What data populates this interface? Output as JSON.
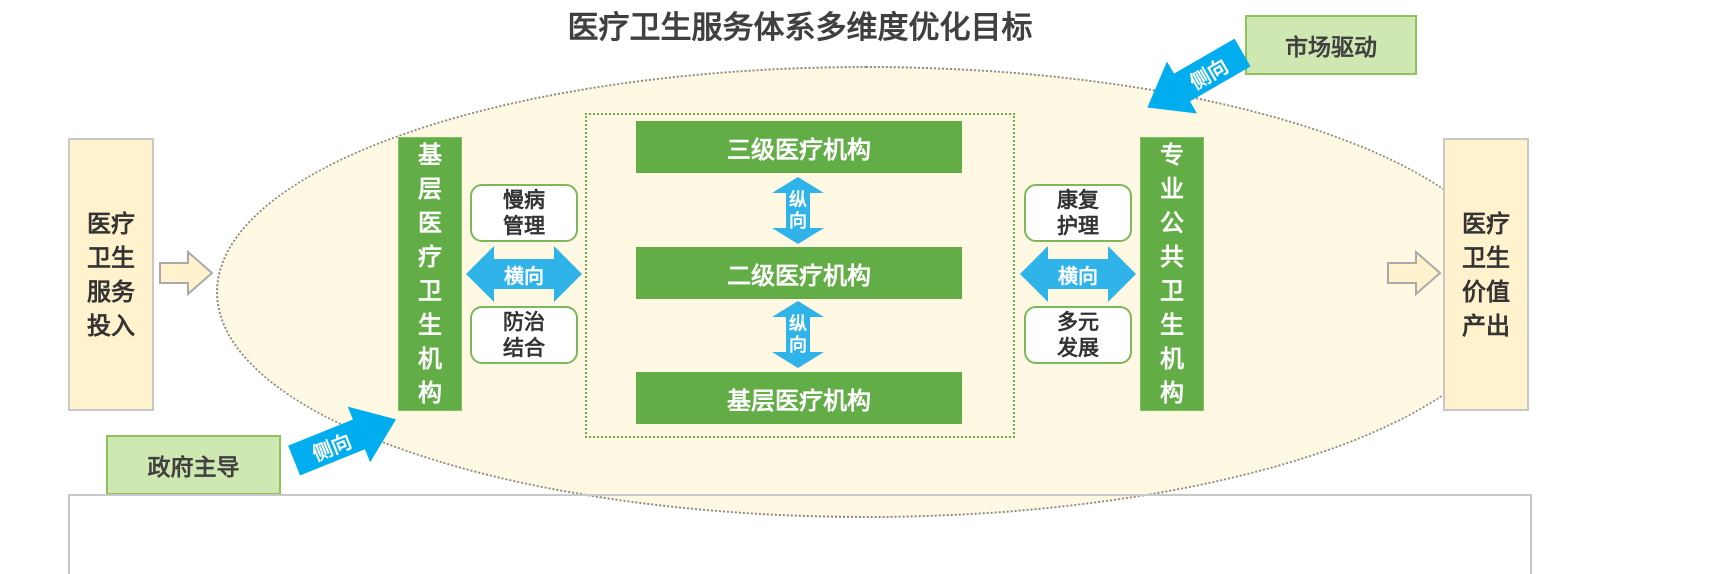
{
  "title": "医疗卫生服务体系多维度优化目标",
  "input_box": "医疗卫生服务投入",
  "output_box": "医疗卫生价值产出",
  "left_column": "基层医疗卫生机构",
  "right_column": "专业公共卫生机构",
  "tiers": {
    "top": "三级医疗机构",
    "middle": "二级医疗机构",
    "bottom": "基层医疗机构"
  },
  "left_boxes": {
    "upper": "慢病管理",
    "lower": "防治结合"
  },
  "right_boxes": {
    "upper": "康复护理",
    "lower": "多元发展"
  },
  "horizontal_label": "横向",
  "vertical_label": "纵向",
  "lateral_label": "侧向",
  "market_driver": "市场驱动",
  "government_lead": "政府主导",
  "colors": {
    "green": "#62ad45",
    "light_green": "#cfe7b0",
    "tan": "#fff2cc",
    "blue": "#00aeef",
    "ellipse": "#fff8e3"
  }
}
